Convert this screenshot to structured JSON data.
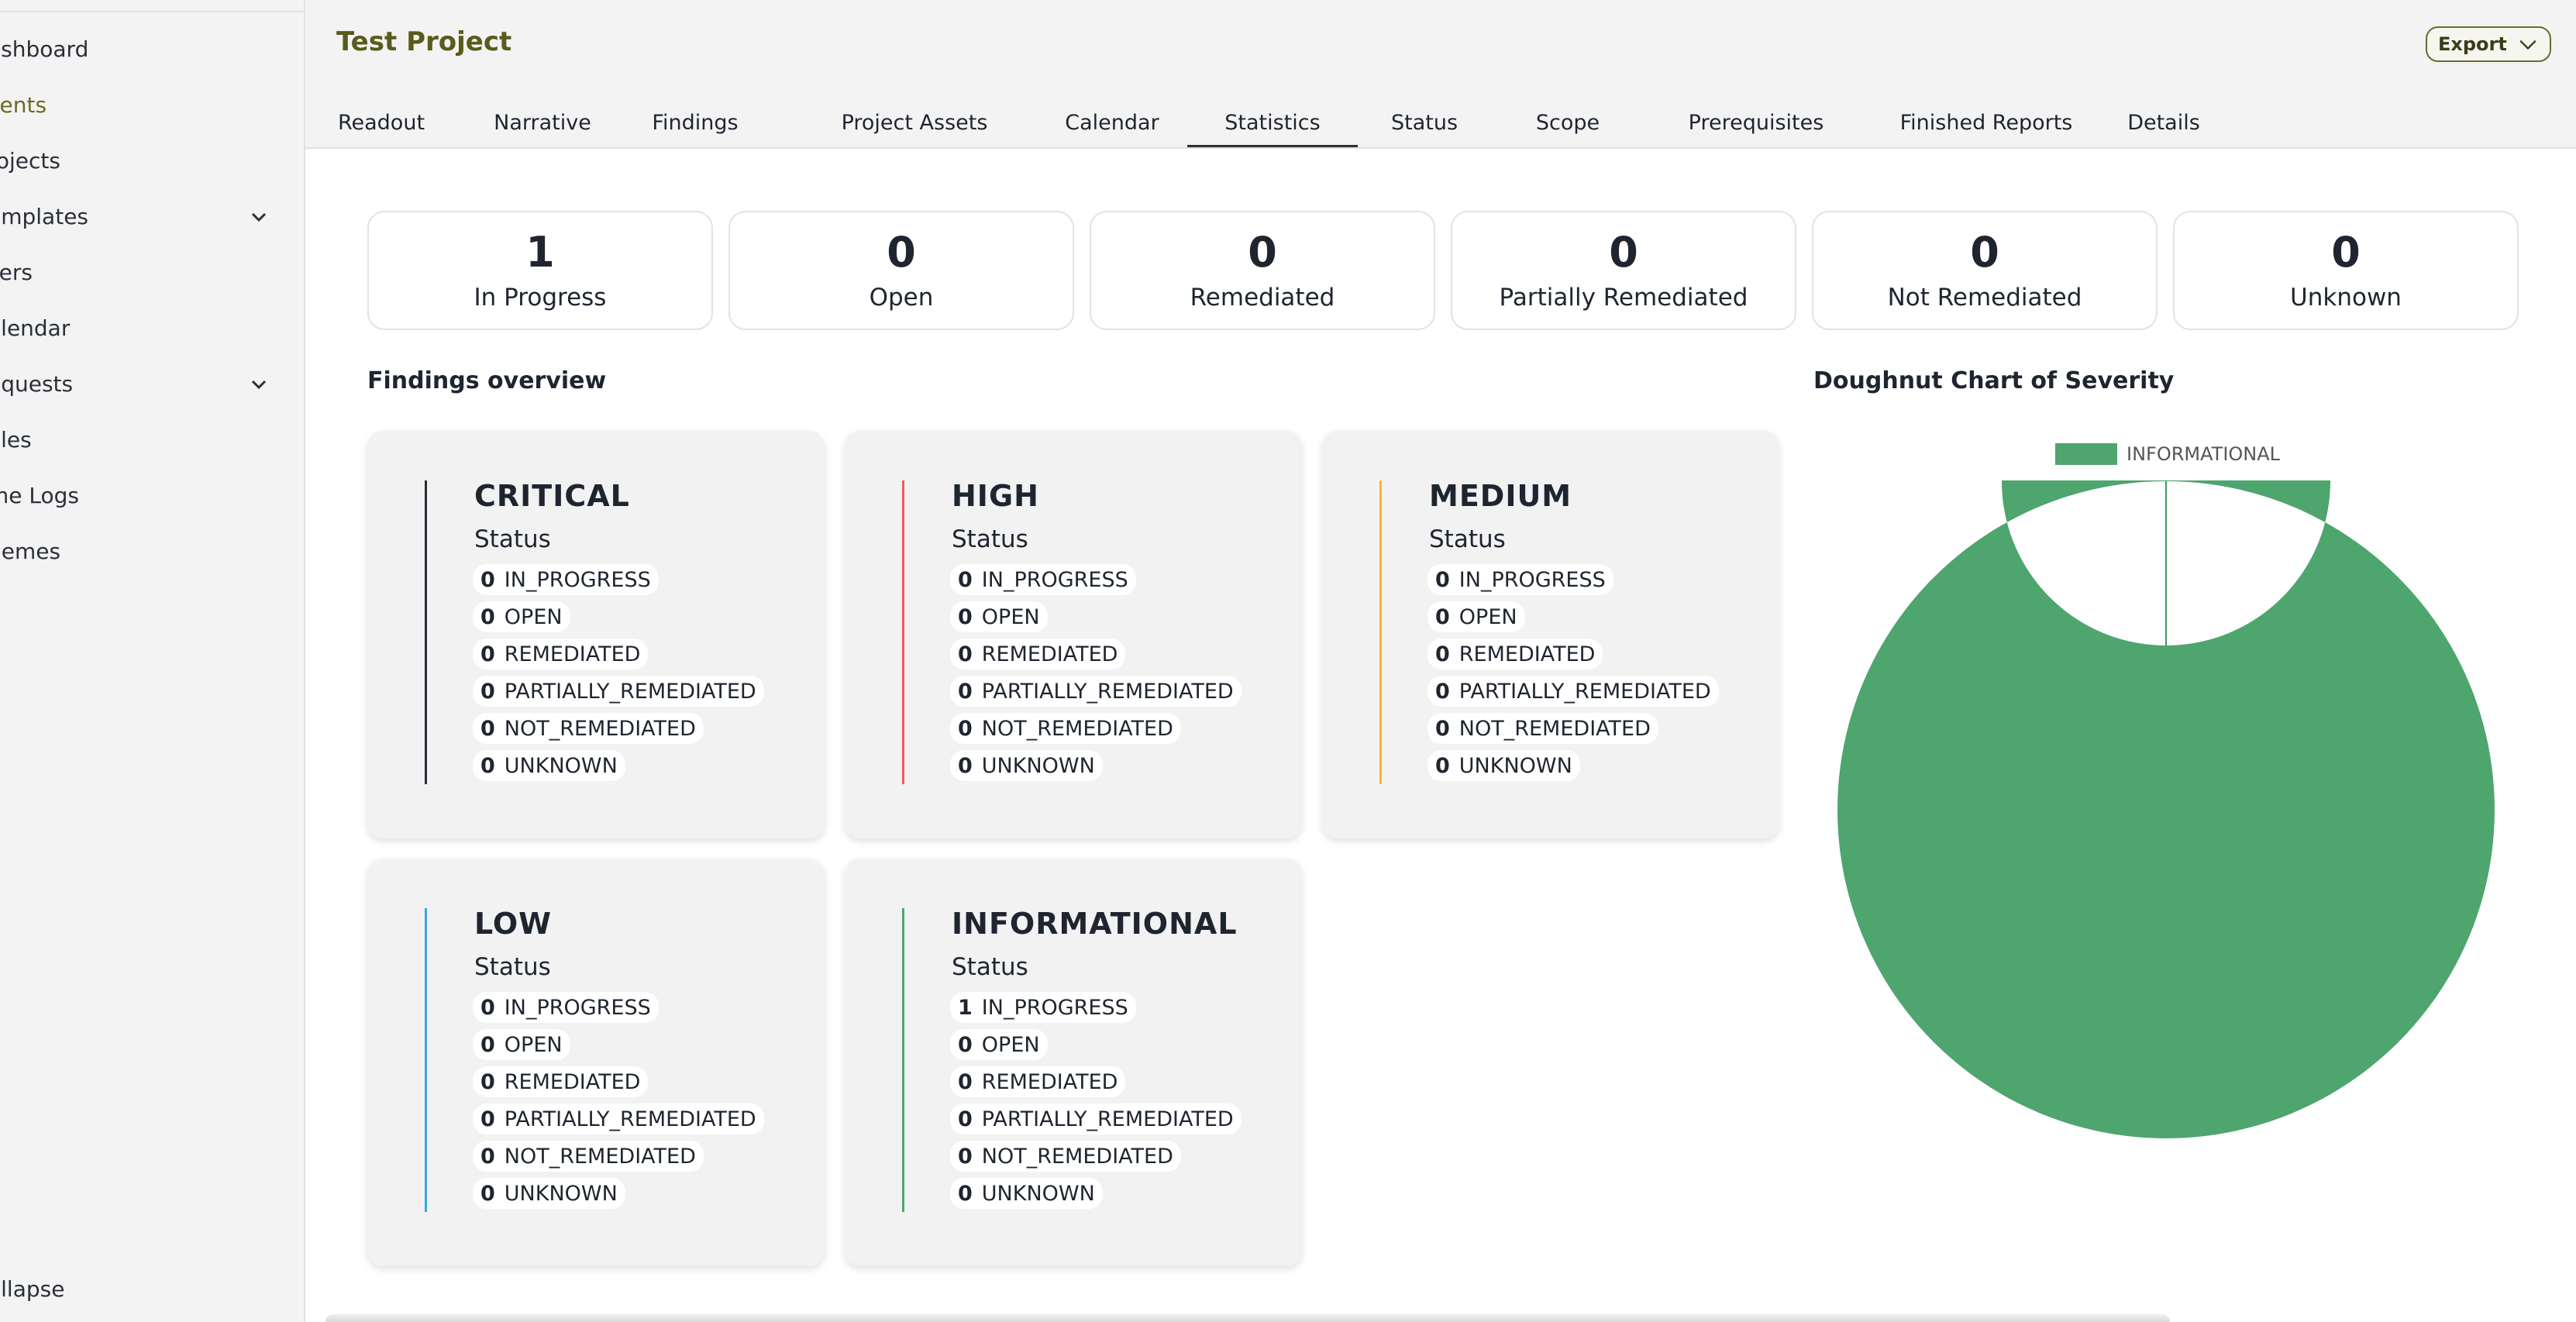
{
  "sidebar": {
    "items": [
      {
        "label": "ashboard",
        "has_chevron": false
      },
      {
        "label": "lients",
        "has_chevron": false,
        "active": true
      },
      {
        "label": "rojects",
        "has_chevron": false
      },
      {
        "label": "emplates",
        "has_chevron": true
      },
      {
        "label": "sers",
        "has_chevron": false
      },
      {
        "label": "alendar",
        "has_chevron": false
      },
      {
        "label": "equests",
        "has_chevron": true
      },
      {
        "label": "oles",
        "has_chevron": false
      },
      {
        "label": "me Logs",
        "has_chevron": false
      },
      {
        "label": "hemes",
        "has_chevron": false
      }
    ],
    "collapse_label": "ollapse"
  },
  "header": {
    "title": "Test Project",
    "export_label": "Export",
    "tabs": [
      "Readout",
      "Narrative",
      "Findings",
      "Project Assets",
      "Calendar",
      "Statistics",
      "Status",
      "Scope",
      "Prerequisites",
      "Finished Reports",
      "Details"
    ],
    "active_tab": "Statistics"
  },
  "stats": [
    {
      "value": "1",
      "label": "In Progress"
    },
    {
      "value": "0",
      "label": "Open"
    },
    {
      "value": "0",
      "label": "Remediated"
    },
    {
      "value": "0",
      "label": "Partially Remediated"
    },
    {
      "value": "0",
      "label": "Not Remediated"
    },
    {
      "value": "0",
      "label": "Unknown"
    }
  ],
  "findings_overview_title": "Findings overview",
  "severities": [
    {
      "name": "CRITICAL",
      "status_label": "Status",
      "color": "#2a2f38",
      "rows": [
        {
          "count": "0",
          "status": "IN_PROGRESS"
        },
        {
          "count": "0",
          "status": "OPEN"
        },
        {
          "count": "0",
          "status": "REMEDIATED"
        },
        {
          "count": "0",
          "status": "PARTIALLY_REMEDIATED"
        },
        {
          "count": "0",
          "status": "NOT_REMEDIATED"
        },
        {
          "count": "0",
          "status": "UNKNOWN"
        }
      ]
    },
    {
      "name": "HIGH",
      "status_label": "Status",
      "color": "#ef5b5b",
      "rows": [
        {
          "count": "0",
          "status": "IN_PROGRESS"
        },
        {
          "count": "0",
          "status": "OPEN"
        },
        {
          "count": "0",
          "status": "REMEDIATED"
        },
        {
          "count": "0",
          "status": "PARTIALLY_REMEDIATED"
        },
        {
          "count": "0",
          "status": "NOT_REMEDIATED"
        },
        {
          "count": "0",
          "status": "UNKNOWN"
        }
      ]
    },
    {
      "name": "MEDIUM",
      "status_label": "Status",
      "color": "#f5b82a",
      "rows": [
        {
          "count": "0",
          "status": "IN_PROGRESS"
        },
        {
          "count": "0",
          "status": "OPEN"
        },
        {
          "count": "0",
          "status": "REMEDIATED"
        },
        {
          "count": "0",
          "status": "PARTIALLY_REMEDIATED"
        },
        {
          "count": "0",
          "status": "NOT_REMEDIATED"
        },
        {
          "count": "0",
          "status": "UNKNOWN"
        }
      ]
    },
    {
      "name": "LOW",
      "status_label": "Status",
      "color": "#3aa7e0",
      "rows": [
        {
          "count": "0",
          "status": "IN_PROGRESS"
        },
        {
          "count": "0",
          "status": "OPEN"
        },
        {
          "count": "0",
          "status": "REMEDIATED"
        },
        {
          "count": "0",
          "status": "PARTIALLY_REMEDIATED"
        },
        {
          "count": "0",
          "status": "NOT_REMEDIATED"
        },
        {
          "count": "0",
          "status": "UNKNOWN"
        }
      ]
    },
    {
      "name": "INFORMATIONAL",
      "status_label": "Status",
      "color": "#4ea56e",
      "rows": [
        {
          "count": "1",
          "status": "IN_PROGRESS"
        },
        {
          "count": "0",
          "status": "OPEN"
        },
        {
          "count": "0",
          "status": "REMEDIATED"
        },
        {
          "count": "0",
          "status": "PARTIALLY_REMEDIATED"
        },
        {
          "count": "0",
          "status": "NOT_REMEDIATED"
        },
        {
          "count": "0",
          "status": "UNKNOWN"
        }
      ]
    }
  ],
  "chart_data": {
    "type": "pie",
    "title": "Doughnut Chart of Severity",
    "categories": [
      "INFORMATIONAL"
    ],
    "values": [
      1
    ],
    "colors": [
      "#4ea56e"
    ],
    "legend": "top"
  }
}
